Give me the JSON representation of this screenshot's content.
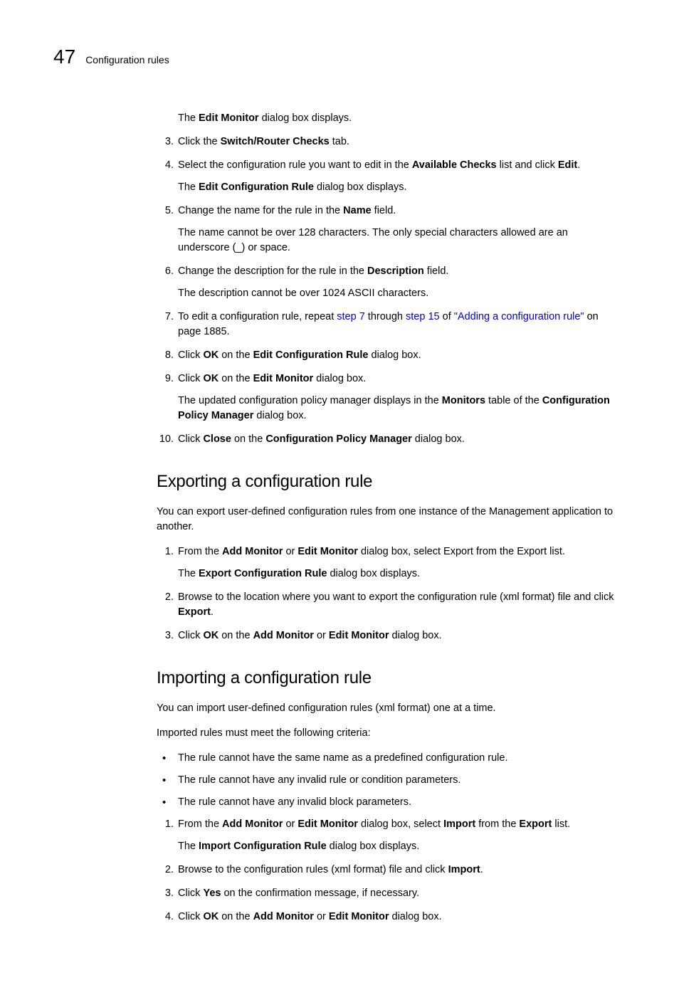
{
  "header": {
    "page_number": "47",
    "title": "Configuration rules"
  },
  "top_para": {
    "t1": "The ",
    "b1": "Edit Monitor",
    "t2": " dialog box displays."
  },
  "step3": {
    "num": "3.",
    "t1": "Click the ",
    "b1": "Switch/Router Checks",
    "t2": " tab."
  },
  "step4": {
    "num": "4.",
    "t1": "Select the configuration rule you want to edit in the ",
    "b1": "Available Checks",
    "t2": " list and click ",
    "b2": "Edit",
    "t3": ".",
    "sub_t1": "The ",
    "sub_b1": "Edit Configuration Rule",
    "sub_t2": " dialog box displays."
  },
  "step5": {
    "num": "5.",
    "t1": "Change the name for the rule in the ",
    "b1": "Name",
    "t2": " field.",
    "sub": "The name cannot be over 128 characters. The only special characters allowed are an underscore (_) or space."
  },
  "step6": {
    "num": "6.",
    "t1": "Change the description for the rule in the ",
    "b1": "Description",
    "t2": " field.",
    "sub": "The description cannot be over 1024 ASCII characters."
  },
  "step7": {
    "num": "7.",
    "t1": "To edit a configuration rule, repeat ",
    "l1": "step 7",
    "t2": " through ",
    "l2": "step 15",
    "t3": " of ",
    "l3": "\"Adding a configuration rule\"",
    "t4": " on page 1885."
  },
  "step8": {
    "num": "8.",
    "t1": "Click ",
    "b1": "OK",
    "t2": " on the ",
    "b2": "Edit Configuration Rule",
    "t3": " dialog box."
  },
  "step9": {
    "num": "9.",
    "t1": "Click ",
    "b1": "OK",
    "t2": " on the ",
    "b2": "Edit Monitor",
    "t3": " dialog box.",
    "sub_t1": "The updated configuration policy manager displays in the ",
    "sub_b1": "Monitors",
    "sub_t2": " table of the ",
    "sub_b2": "Configuration Policy Manager",
    "sub_t3": " dialog box."
  },
  "step10": {
    "num": "10.",
    "t1": "Click ",
    "b1": "Close",
    "t2": " on the ",
    "b2": "Configuration Policy Manager",
    "t3": " dialog box."
  },
  "h_export": "Exporting a configuration rule",
  "export_intro": "You can export user-defined configuration rules from one instance of the Management application to another.",
  "ex1": {
    "num": "1.",
    "t1": "From the ",
    "b1": "Add Monitor",
    "t2": " or ",
    "b2": "Edit Monitor",
    "t3": " dialog box, select Export from the Export list.",
    "sub_t1": "The ",
    "sub_b1": "Export Configuration Rule",
    "sub_t2": " dialog box displays."
  },
  "ex2": {
    "num": "2.",
    "t1": "Browse to the location where you want to export the configuration rule (xml format) file and click ",
    "b1": "Export",
    "t2": "."
  },
  "ex3": {
    "num": "3.",
    "t1": "Click ",
    "b1": "OK",
    "t2": " on the ",
    "b2": "Add Monitor",
    "t3": " or ",
    "b3": "Edit Monitor",
    "t4": " dialog box."
  },
  "h_import": "Importing a configuration rule",
  "import_intro1": "You can import user-defined configuration rules (xml format) one at a time.",
  "import_intro2": "Imported rules must meet the following criteria:",
  "bul1": "The rule cannot have the same name as a predefined configuration rule.",
  "bul2": "The rule cannot have any invalid rule or condition parameters.",
  "bul3": "The rule cannot have any invalid block parameters.",
  "im1": {
    "num": "1.",
    "t1": "From the ",
    "b1": "Add Monitor",
    "t2": " or ",
    "b2": "Edit Monitor",
    "t3": " dialog box, select ",
    "b3": "Import",
    "t4": " from the ",
    "b4": "Export",
    "t5": " list.",
    "sub_t1": "The ",
    "sub_b1": "Import Configuration Rule",
    "sub_t2": " dialog box displays."
  },
  "im2": {
    "num": "2.",
    "t1": "Browse to the configuration rules (xml format) file and click ",
    "b1": "Import",
    "t2": "."
  },
  "im3": {
    "num": "3.",
    "t1": "Click ",
    "b1": "Yes",
    "t2": " on the confirmation message, if necessary."
  },
  "im4": {
    "num": "4.",
    "t1": "Click ",
    "b1": "OK",
    "t2": " on the ",
    "b2": "Add Monitor",
    "t3": " or ",
    "b3": "Edit Monitor",
    "t4": " dialog box."
  }
}
